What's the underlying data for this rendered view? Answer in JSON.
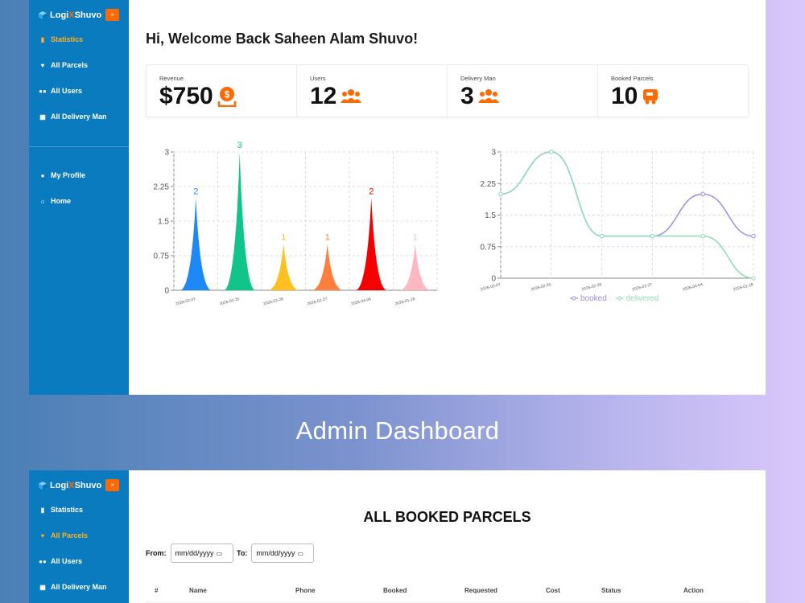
{
  "brand": {
    "name_prefix": "Logi",
    "name_x": "X",
    "name_suffix": "Shuvo",
    "badge": "»"
  },
  "colors": {
    "sidebar": "#0a7bbf",
    "active": "#ffb020",
    "accent": "#ff6a00"
  },
  "top_panel": {
    "nav": [
      {
        "label": "Statistics",
        "icon": "bar-chart-icon",
        "active": true
      },
      {
        "label": "All Parcels",
        "icon": "parcel-icon",
        "active": false
      },
      {
        "label": "All Users",
        "icon": "users-icon",
        "active": false
      },
      {
        "label": "All Delivery Man",
        "icon": "grid-icon",
        "active": false
      },
      {
        "label": "My Profile",
        "icon": "profile-icon",
        "active": false
      },
      {
        "label": "Home",
        "icon": "home-icon",
        "active": false
      }
    ],
    "welcome": "Hi, Welcome Back Saheen Alam Shuvo!",
    "stats": [
      {
        "label": "Revenue",
        "value": "$750",
        "icon": "money-icon"
      },
      {
        "label": "Users",
        "value": "12",
        "icon": "users-group-icon"
      },
      {
        "label": "Delivery Man",
        "value": "3",
        "icon": "users-group-icon"
      },
      {
        "label": "Booked Parcels",
        "value": "10",
        "icon": "truck-icon"
      }
    ]
  },
  "chart_data": [
    {
      "type": "bar",
      "categories": [
        "2026-02-07",
        "2026-02-25",
        "2026-02-26",
        "2026-02-27",
        "2026-04-04",
        "2026-01-18"
      ],
      "values": [
        2,
        3,
        1,
        1,
        2,
        1
      ],
      "colors": [
        "#1e88f5",
        "#10c48a",
        "#ffc021",
        "#ff7e3e",
        "#f50000",
        "#ffb8c2"
      ],
      "yticks": [
        "0",
        "0.75",
        "1.5",
        "2.25",
        "3"
      ],
      "ylim": [
        0,
        3
      ],
      "grid": true
    },
    {
      "type": "line",
      "categories": [
        "2026-02-07",
        "2026-02-25",
        "2026-02-26",
        "2026-02-27",
        "2026-04-04",
        "2026-01-18"
      ],
      "yticks": [
        "0",
        "0.75",
        "1.5",
        "2.25",
        "3"
      ],
      "ylim": [
        0,
        3
      ],
      "grid": true,
      "legend": "bottom",
      "series": [
        {
          "name": "booked",
          "color": "#9b8de8",
          "values": [
            2,
            3,
            1,
            1,
            2,
            1
          ]
        },
        {
          "name": "delivered",
          "color": "#8fdcb4",
          "values": [
            2,
            3,
            1,
            1,
            1,
            0
          ]
        }
      ]
    }
  ],
  "caption": "Admin Dashboard",
  "bottom_panel": {
    "nav": [
      {
        "label": "Statistics",
        "icon": "bar-chart-icon",
        "active": false
      },
      {
        "label": "All Parcels",
        "icon": "parcel-icon",
        "active": true
      },
      {
        "label": "All Users",
        "icon": "users-icon",
        "active": false
      },
      {
        "label": "All Delivery Man",
        "icon": "grid-icon",
        "active": false
      }
    ],
    "title": "ALL BOOKED PARCELS",
    "from_label": "From:",
    "to_label": "To:",
    "date_placeholder": "mm/dd/yyyy",
    "columns": [
      "#",
      "Name",
      "Phone",
      "Booked",
      "Requested",
      "Cost",
      "Status",
      "Action"
    ]
  }
}
